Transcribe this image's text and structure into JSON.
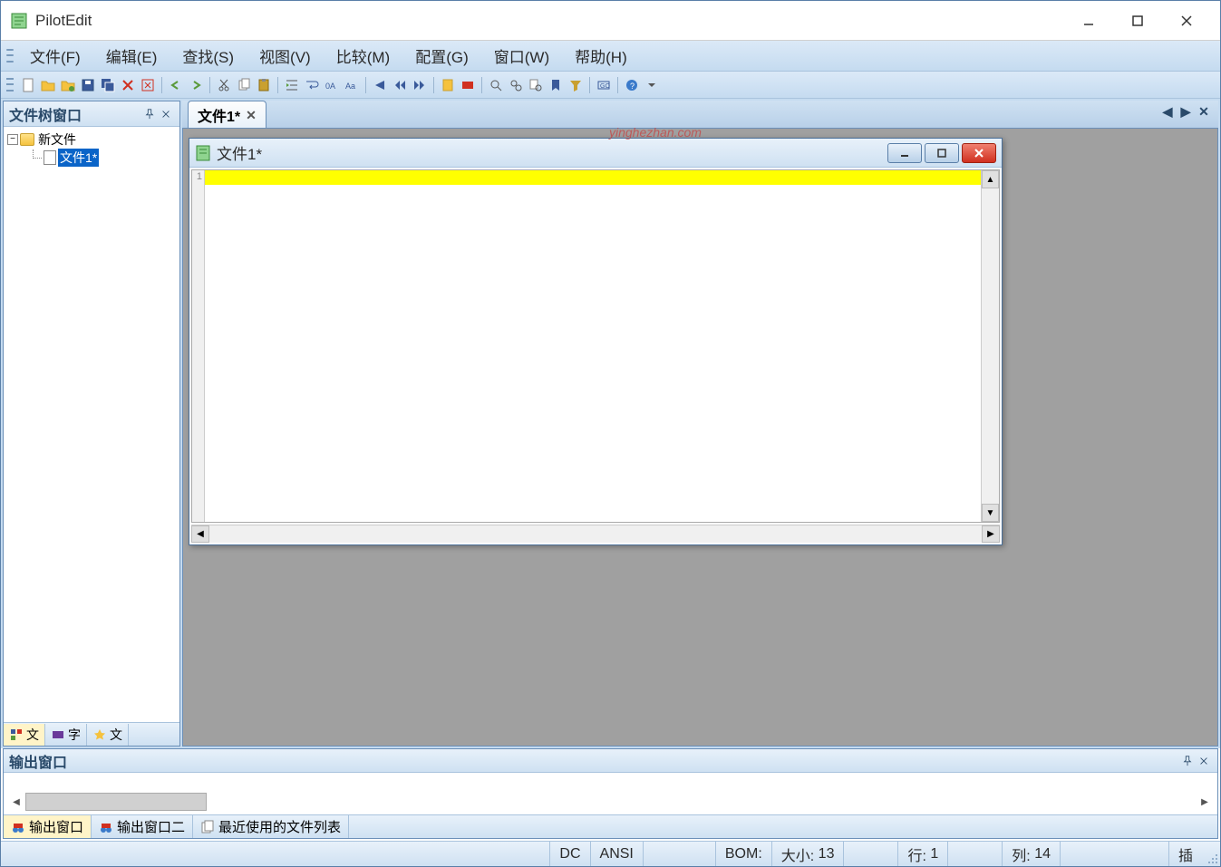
{
  "app": {
    "title": "PilotEdit"
  },
  "menu": {
    "file": "文件(F)",
    "edit": "编辑(E)",
    "search": "查找(S)",
    "view": "视图(V)",
    "compare": "比较(M)",
    "config": "配置(G)",
    "window": "窗口(W)",
    "help": "帮助(H)"
  },
  "sidebar": {
    "title": "文件树窗口",
    "root_label": "新文件",
    "child_label": "文件1*",
    "tabs": {
      "t1": "文",
      "t2": "字",
      "t3": "文"
    }
  },
  "tabs": {
    "doc1": "文件1*"
  },
  "doc": {
    "title": "文件1*",
    "line1_num": "1"
  },
  "output": {
    "title": "输出窗口",
    "tab1": "输出窗口",
    "tab2": "输出窗口二",
    "tab3": "最近使用的文件列表"
  },
  "status": {
    "enc_prefix": "DC",
    "encoding": "ANSI",
    "bom": "BOM:",
    "size_label": "大小:",
    "size_value": "13",
    "row_label": "行:",
    "row_value": "1",
    "col_label": "列:",
    "col_value": "14",
    "insert": "插"
  },
  "watermark": "yinghezhan.com"
}
